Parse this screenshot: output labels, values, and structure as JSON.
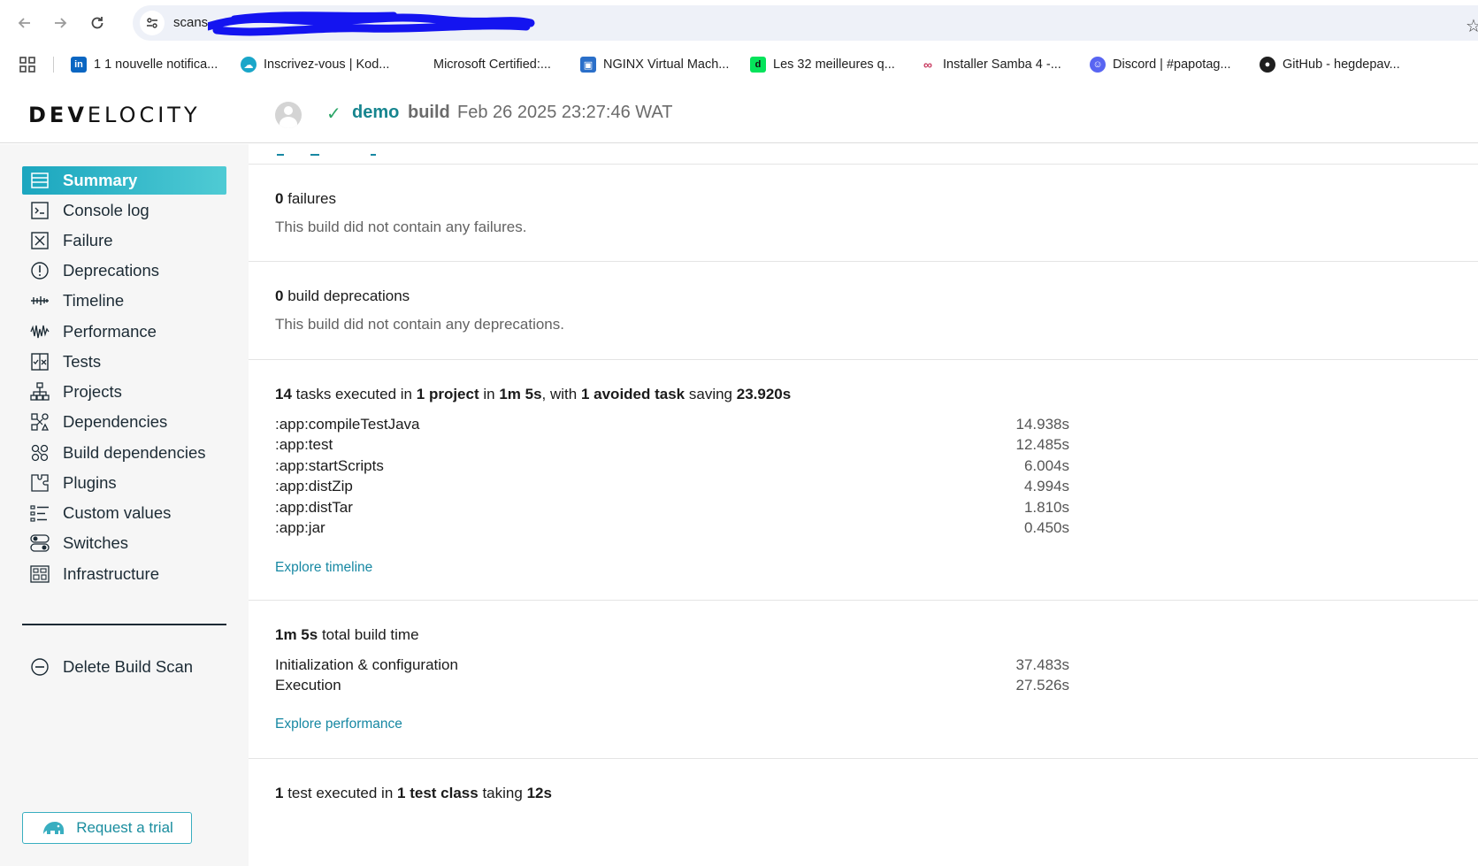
{
  "browser": {
    "url": "scans",
    "bookmarks": [
      {
        "label": "1 1 nouvelle notifica...",
        "icon": "linkedin-icon",
        "color": "#0a66c2"
      },
      {
        "label": "Inscrivez-vous | Kod...",
        "icon": "kodekloud-icon",
        "color": "#1aa6c9"
      },
      {
        "label": "Microsoft Certified:...",
        "icon": "microsoft-icon",
        "color": "#f25022"
      },
      {
        "label": "NGINX Virtual Mach...",
        "icon": "nginx-vm-icon",
        "color": "#2a6fc9"
      },
      {
        "label": "Les 32 meilleures q...",
        "icon": "datacamp-icon",
        "color": "#05e35b"
      },
      {
        "label": "Installer Samba 4 -...",
        "icon": "samba-icon",
        "color": "#c8385e"
      },
      {
        "label": "Discord | #papotag...",
        "icon": "discord-icon",
        "color": "#5865f2"
      },
      {
        "label": "GitHub - hegdepav...",
        "icon": "github-icon",
        "color": "#1f1f1f"
      }
    ]
  },
  "header": {
    "logo_bold": "DEV",
    "logo_rest": "ELOCITY",
    "project": "demo",
    "task": "build",
    "date": "Feb 26 2025 23:27:46 WAT"
  },
  "sidebar": {
    "items": [
      {
        "label": "Summary",
        "icon": "summary-icon"
      },
      {
        "label": "Console log",
        "icon": "console-icon"
      },
      {
        "label": "Failure",
        "icon": "failure-icon"
      },
      {
        "label": "Deprecations",
        "icon": "deprecation-icon"
      },
      {
        "label": "Timeline",
        "icon": "timeline-icon"
      },
      {
        "label": "Performance",
        "icon": "performance-icon"
      },
      {
        "label": "Tests",
        "icon": "tests-icon"
      },
      {
        "label": "Projects",
        "icon": "projects-icon"
      },
      {
        "label": "Dependencies",
        "icon": "dependencies-icon"
      },
      {
        "label": "Build dependencies",
        "icon": "build-dependencies-icon"
      },
      {
        "label": "Plugins",
        "icon": "plugins-icon"
      },
      {
        "label": "Custom values",
        "icon": "custom-values-icon"
      },
      {
        "label": "Switches",
        "icon": "switches-icon"
      },
      {
        "label": "Infrastructure",
        "icon": "infrastructure-icon"
      }
    ],
    "delete_label": "Delete Build Scan",
    "trial_label": "Request a trial"
  },
  "failures": {
    "count": "0",
    "title_rest": "failures",
    "desc": "This build did not contain any failures."
  },
  "deprecations": {
    "count": "0",
    "title_rest": "build deprecations",
    "desc": "This build did not contain any deprecations."
  },
  "tasks": {
    "count": "14",
    "t1": "tasks executed in",
    "projects": "1",
    "t2": "project",
    "t3": "in",
    "duration": "1m 5s",
    "t4": ", with",
    "avoided": "1 avoided task",
    "t5": "saving",
    "saving": "23.920s",
    "rows": [
      {
        "name": ":app:compileTestJava",
        "duration": "14.938s"
      },
      {
        "name": ":app:test",
        "duration": "12.485s"
      },
      {
        "name": ":app:startScripts",
        "duration": "6.004s"
      },
      {
        "name": ":app:distZip",
        "duration": "4.994s"
      },
      {
        "name": ":app:distTar",
        "duration": "1.810s"
      },
      {
        "name": ":app:jar",
        "duration": "0.450s"
      }
    ],
    "link": "Explore timeline"
  },
  "performance": {
    "total": "1m 5s",
    "title_rest": "total build time",
    "rows": [
      {
        "name": "Initialization & configuration",
        "duration": "37.483s"
      },
      {
        "name": "Execution",
        "duration": "27.526s"
      }
    ],
    "link": "Explore performance"
  },
  "tests": {
    "count": "1",
    "t1": "test executed in",
    "classes": "1",
    "t2": "test class",
    "t3": "taking",
    "time": "12s"
  }
}
